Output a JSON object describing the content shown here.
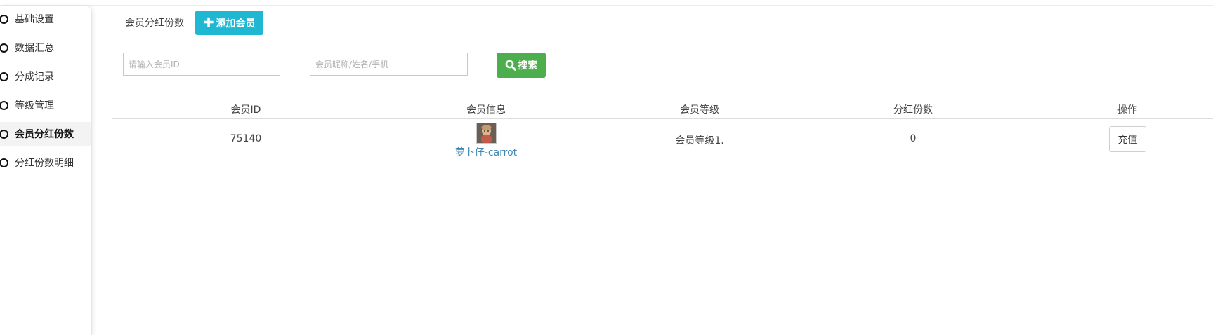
{
  "sidebar": {
    "items": [
      {
        "label": "基础设置"
      },
      {
        "label": "数据汇总"
      },
      {
        "label": "分成记录"
      },
      {
        "label": "等级管理"
      },
      {
        "label": "会员分红份数"
      },
      {
        "label": "分红份数明细"
      }
    ],
    "active_index": 4
  },
  "tabs": {
    "current_label": "会员分红份数",
    "add_member_label": "添加会员"
  },
  "search": {
    "member_id_placeholder": "请输入会员ID",
    "member_id_value": "",
    "keyword_placeholder": "会员昵称/姓名/手机",
    "keyword_value": "",
    "button_label": "搜索"
  },
  "table": {
    "columns": [
      "会员ID",
      "会员信息",
      "会员等级",
      "分红份数",
      "操作"
    ],
    "rows": [
      {
        "member_id": "75140",
        "nickname": "萝卜仔-carrot",
        "level": "会员等级1.",
        "shares": "0",
        "action_label": "充值"
      }
    ]
  },
  "colors": {
    "add_button": "#1fb7d2",
    "search_button": "#4cae4c",
    "member_link": "#3f89b4"
  }
}
